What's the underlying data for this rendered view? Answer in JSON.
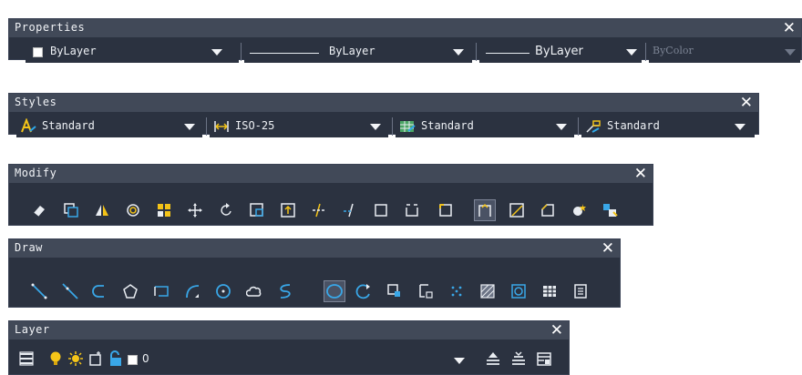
{
  "properties": {
    "title": "Properties",
    "close": "✕",
    "color": "ByLayer",
    "linetype": "ByLayer",
    "lineweight": "ByLayer",
    "plotstyle": "ByColor"
  },
  "styles": {
    "title": "Styles",
    "close": "✕",
    "text_style": "Standard",
    "dim_style": "ISO-25",
    "table_style": "Standard",
    "mleader_style": "Standard"
  },
  "modify": {
    "title": "Modify",
    "close": "✕",
    "icons": [
      "erase-icon",
      "copy-icon",
      "mirror-icon",
      "offset-icon",
      "array-icon",
      "move-icon",
      "rotate-icon",
      "scale-icon",
      "stretch-icon",
      "trim-icon",
      "extend-icon",
      "break-at-point-icon",
      "break-icon",
      "join-icon",
      "chamfer-icon",
      "fillet-icon",
      "explode-icon",
      "blend-icon"
    ]
  },
  "draw": {
    "title": "Draw",
    "close": "✕",
    "icons": [
      "line-icon",
      "construction-line-icon",
      "polyline-icon",
      "polygon-icon",
      "rectangle-icon",
      "arc-icon",
      "circle-icon",
      "revision-cloud-icon",
      "spline-icon",
      "ellipse-icon",
      "ellipse-arc-icon",
      "insert-block-icon",
      "make-block-icon",
      "point-icon",
      "hatch-icon",
      "region-icon",
      "table-icon",
      "multiline-text-icon"
    ]
  },
  "layer": {
    "title": "Layer",
    "close": "✕",
    "current_layer": "0",
    "colors": {
      "bulb": "#f5c518",
      "sun": "#f5c518",
      "lock": "#39a7e8"
    }
  }
}
